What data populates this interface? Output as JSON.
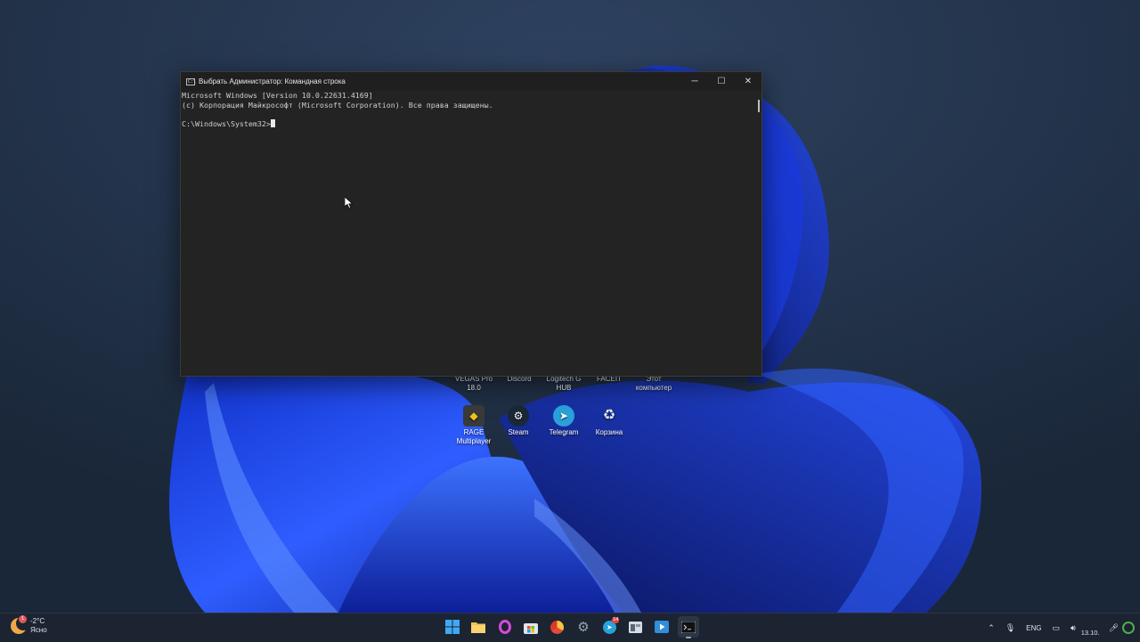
{
  "cmd": {
    "title": "Выбрать Администратор: Командная строка",
    "app_icon_text": "C:\\",
    "line1": "Microsoft Windows [Version 10.0.22631.4169]",
    "line2": "(c) Корпорация Майкрософт (Microsoft Corporation). Все права защищены.",
    "prompt": "C:\\Windows\\System32>",
    "minimize_glyph": "─",
    "maximize_glyph": "☐",
    "close_glyph": "✕"
  },
  "desktop": {
    "row1": [
      {
        "label1": "VEGAS Pro",
        "label2": "18.0"
      },
      {
        "label1": "Discord",
        "label2": ""
      },
      {
        "label1": "Logitech G",
        "label2": "HUB"
      },
      {
        "label1": "FACEIT",
        "label2": ""
      },
      {
        "label1": "Этот",
        "label2": "компьютер"
      }
    ],
    "row2": [
      {
        "label1": "RAGE",
        "label2": "Multiplayer",
        "icon": "rage-mp-icon",
        "color": "#3a3a3a"
      },
      {
        "label1": "Steam",
        "label2": "",
        "icon": "steam-icon",
        "color": "#1b2838"
      },
      {
        "label1": "Telegram",
        "label2": "",
        "icon": "telegram-icon",
        "color": "#2aa1da"
      },
      {
        "label1": "Корзина",
        "label2": "",
        "icon": "recycle-bin-icon",
        "color": "#dfe8f2"
      }
    ]
  },
  "taskbar": {
    "weather_temp": "-2°C",
    "weather_desc": "Ясно",
    "weather_badge": "1",
    "icons": [
      {
        "name": "start",
        "icon": "windows-start-icon",
        "color": "#3fa9f5"
      },
      {
        "name": "explorer",
        "icon": "file-explorer-icon",
        "color": "#f2c14e"
      },
      {
        "name": "opera",
        "icon": "opera-icon",
        "color": "#d54bd8"
      },
      {
        "name": "store",
        "icon": "microsoft-store-icon",
        "color": "#dfe6f0"
      },
      {
        "name": "yandex",
        "icon": "browser-icon",
        "color": "#f4c542"
      },
      {
        "name": "settings",
        "icon": "settings-gear-icon",
        "color": "#9aa4b2"
      },
      {
        "name": "telegram",
        "icon": "telegram-icon",
        "color": "#2aa1da",
        "badge": "14"
      },
      {
        "name": "app",
        "icon": "app-window-icon",
        "color": "#d7dde6"
      },
      {
        "name": "media",
        "icon": "media-player-icon",
        "color": "#2f8fd8"
      },
      {
        "name": "terminal",
        "icon": "terminal-icon",
        "color": "#222222"
      }
    ],
    "lang": "ENG",
    "date": "13.10."
  }
}
